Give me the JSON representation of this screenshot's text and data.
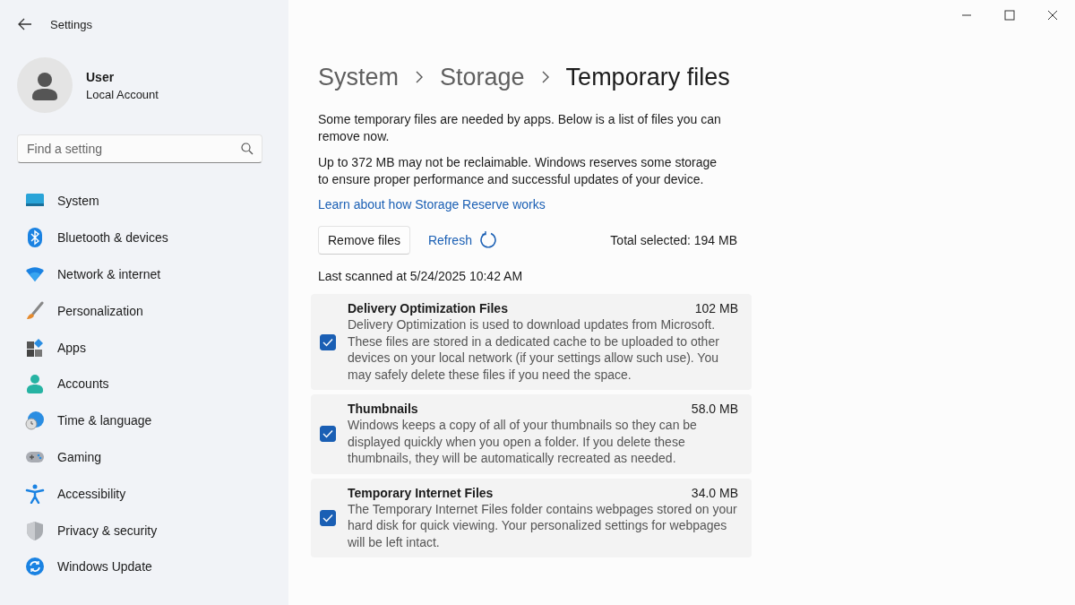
{
  "window": {
    "title": "Settings"
  },
  "account": {
    "name": "User",
    "type": "Local Account"
  },
  "search": {
    "placeholder": "Find a setting"
  },
  "sidebar": {
    "items": [
      {
        "label": "System"
      },
      {
        "label": "Bluetooth & devices"
      },
      {
        "label": "Network & internet"
      },
      {
        "label": "Personalization"
      },
      {
        "label": "Apps"
      },
      {
        "label": "Accounts"
      },
      {
        "label": "Time & language"
      },
      {
        "label": "Gaming"
      },
      {
        "label": "Accessibility"
      },
      {
        "label": "Privacy & security"
      },
      {
        "label": "Windows Update"
      }
    ]
  },
  "breadcrumb": [
    {
      "label": "System",
      "current": false
    },
    {
      "label": "Storage",
      "current": false
    },
    {
      "label": "Temporary files",
      "current": true
    }
  ],
  "description": [
    "Some temporary files are needed by apps. Below is a list of files you can remove now.",
    "Up to 372 MB may not be reclaimable. Windows reserves some storage to ensure proper performance and successful updates of your device."
  ],
  "link": "Learn about how Storage Reserve works",
  "actions": {
    "remove": "Remove files",
    "refresh": "Refresh",
    "total": "Total selected: 194 MB"
  },
  "last_scanned": "Last scanned at 5/24/2025 10:42 AM",
  "files": [
    {
      "name": "Delivery Optimization Files",
      "size": "102 MB",
      "checked": true,
      "description": "Delivery Optimization is used to download updates from Microsoft. These files are stored in a dedicated cache to be uploaded to other devices on your local network (if your settings allow such use). You may safely delete these files if you need the space."
    },
    {
      "name": "Thumbnails",
      "size": "58.0 MB",
      "checked": true,
      "description": "Windows keeps a copy of all of your thumbnails so they can be displayed quickly when you open a folder. If you delete these thumbnails, they will be automatically recreated as needed."
    },
    {
      "name": "Temporary Internet Files",
      "size": "34.0 MB",
      "checked": true,
      "description": "The Temporary Internet Files folder contains webpages stored on your hard disk for quick viewing. Your personalized settings for webpages will be left intact."
    }
  ]
}
